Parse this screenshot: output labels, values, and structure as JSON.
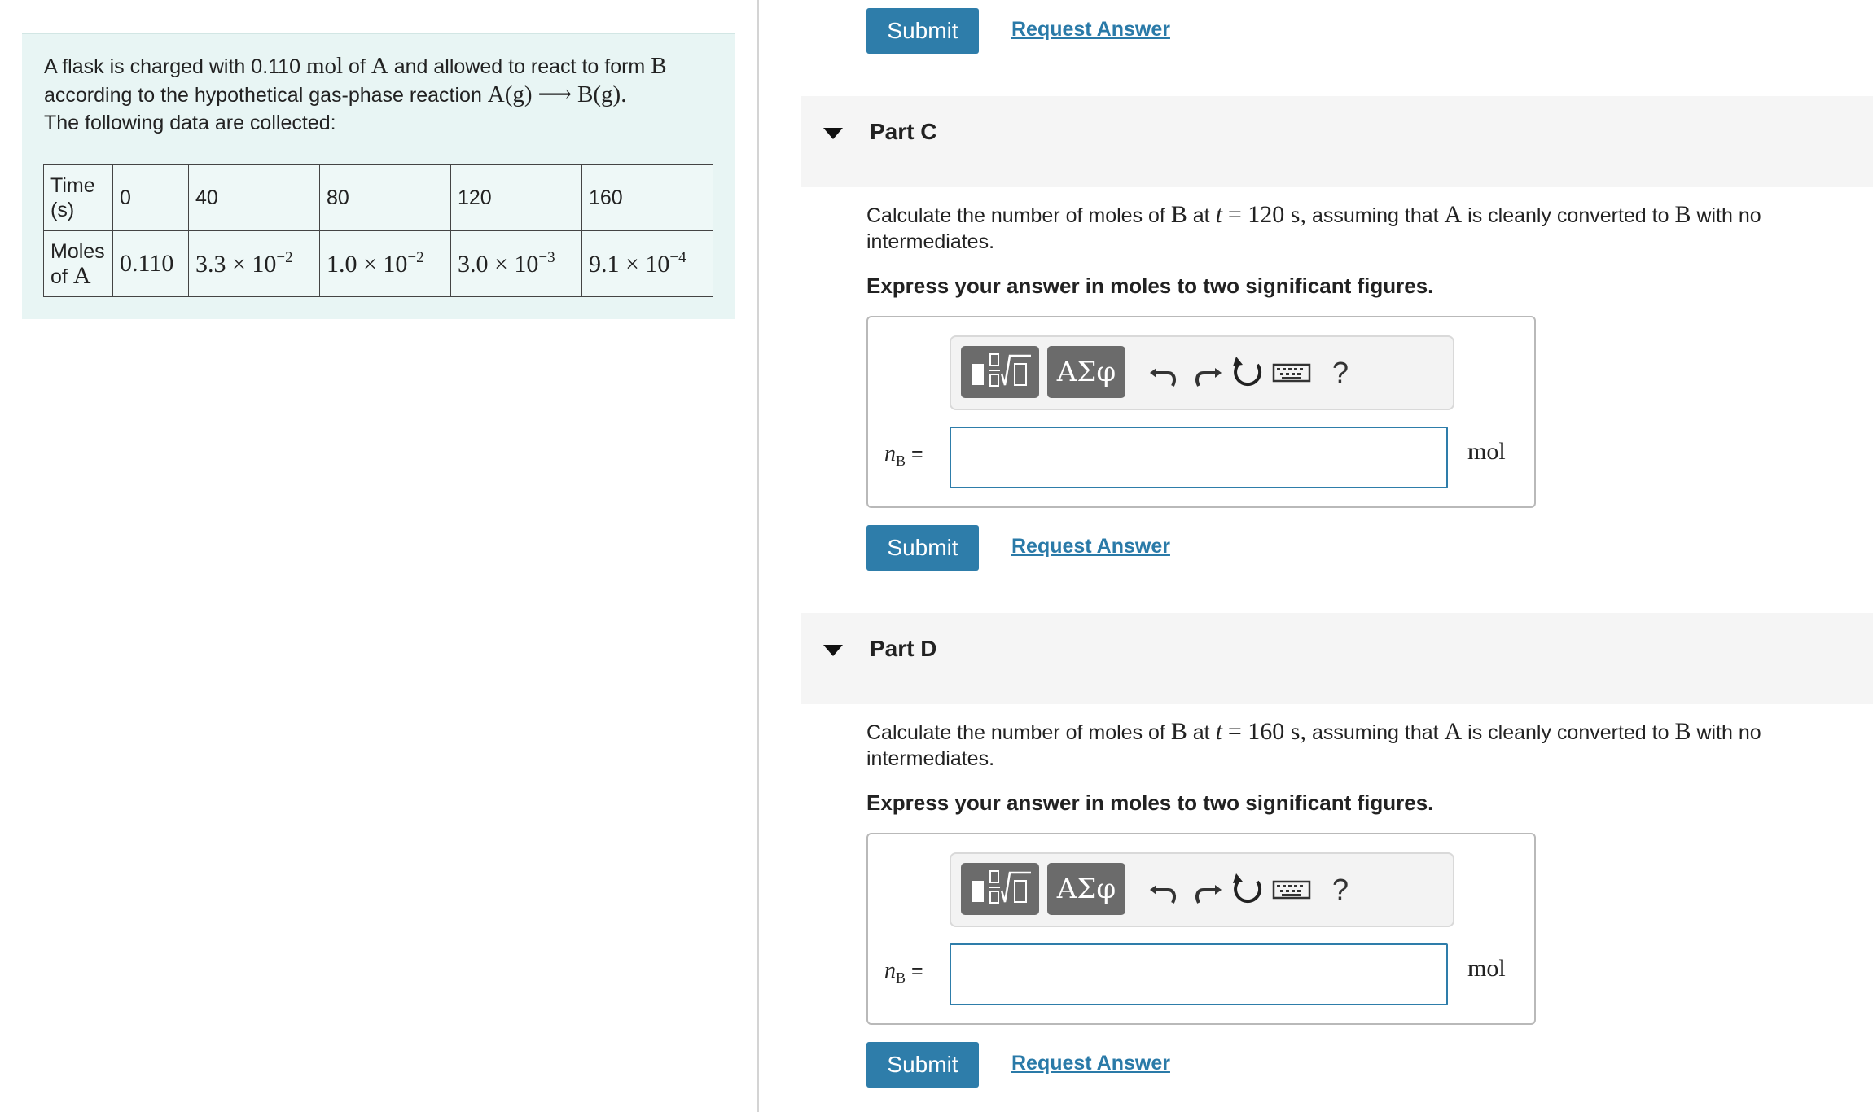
{
  "problem": {
    "intro_text_1": "A flask is charged with 0.110",
    "intro_unit_mol": "mol",
    "intro_text_2": "of",
    "intro_species_a": "A",
    "intro_text_3": "and allowed to react to form",
    "intro_species_b": "B",
    "intro_text_4": "according to the hypothetical gas-phase reaction",
    "reaction_reactant": "A(g)",
    "reaction_arrow": "⟶",
    "reaction_product": "B(g).",
    "intro_text_5": "The following data are collected:",
    "table": {
      "row1_header_1": "Time",
      "row1_header_2": "(s)",
      "times": [
        "0",
        "40",
        "80",
        "120",
        "160"
      ],
      "row2_header_1": "Moles",
      "row2_header_2": "of",
      "row2_header_species": "A",
      "moles": [
        {
          "mant": "0.110",
          "exp": ""
        },
        {
          "mant": "3.3 × 10",
          "exp": "−2"
        },
        {
          "mant": "1.0 × 10",
          "exp": "−2"
        },
        {
          "mant": "3.0 × 10",
          "exp": "−3"
        },
        {
          "mant": "9.1 × 10",
          "exp": "−4"
        }
      ]
    }
  },
  "top_actions": {
    "submit": "Submit",
    "request": "Request Answer"
  },
  "part_c": {
    "title": "Part C",
    "q_text_1": "Calculate the number of moles of",
    "q_species_b": "B",
    "q_text_2": "at",
    "q_var_t": "t",
    "q_eq": "= 120 s,",
    "q_text_3": "assuming that",
    "q_species_a": "A",
    "q_text_4": "is cleanly converted to",
    "q_species_b2": "B",
    "q_text_5": "with no intermediates.",
    "instruction": "Express your answer in moles to two significant figures.",
    "symbols_button": "ΑΣφ",
    "help": "?",
    "var_n": "n",
    "var_sub": "B",
    "var_eq": "=",
    "input_value": "",
    "unit": "mol",
    "submit": "Submit",
    "request": "Request Answer"
  },
  "part_d": {
    "title": "Part D",
    "q_text_1": "Calculate the number of moles of",
    "q_species_b": "B",
    "q_text_2": "at",
    "q_var_t": "t",
    "q_eq": "= 160 s,",
    "q_text_3": "assuming that",
    "q_species_a": "A",
    "q_text_4": "is cleanly converted to",
    "q_species_b2": "B",
    "q_text_5": "with no intermediates.",
    "instruction": "Express your answer in moles to two significant figures.",
    "symbols_button": "ΑΣφ",
    "help": "?",
    "var_n": "n",
    "var_sub": "B",
    "var_eq": "=",
    "input_value": "",
    "unit": "mol",
    "submit": "Submit",
    "request": "Request Answer"
  }
}
